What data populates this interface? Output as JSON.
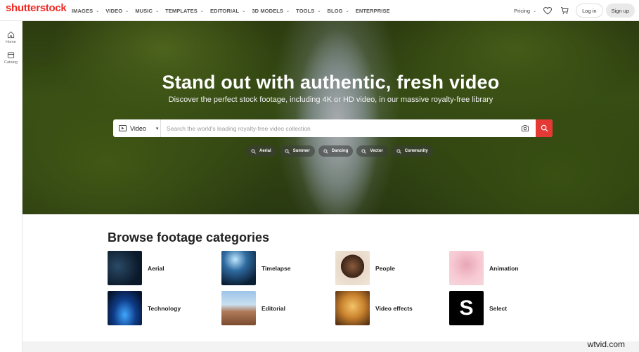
{
  "brand": {
    "logo": "shutterstock",
    "accent": "#ee2b24",
    "search_button_color": "#e53935"
  },
  "nav": {
    "items": [
      {
        "label": "IMAGES",
        "dropdown": true
      },
      {
        "label": "VIDEO",
        "dropdown": true
      },
      {
        "label": "MUSIC",
        "dropdown": true
      },
      {
        "label": "TEMPLATES",
        "dropdown": true
      },
      {
        "label": "EDITORIAL",
        "dropdown": true
      },
      {
        "label": "3D MODELS",
        "dropdown": true
      },
      {
        "label": "TOOLS",
        "dropdown": true
      },
      {
        "label": "BLOG",
        "dropdown": true
      },
      {
        "label": "ENTERPRISE",
        "dropdown": false
      }
    ],
    "pricing": "Pricing",
    "login": "Log in",
    "signup": "Sign up",
    "icons": [
      "heart-icon",
      "cart-icon"
    ]
  },
  "sidebar": {
    "items": [
      {
        "label": "Home",
        "icon": "home-icon"
      },
      {
        "label": "Catalog",
        "icon": "catalog-icon"
      }
    ]
  },
  "hero": {
    "title": "Stand out with authentic, fresh video",
    "subtitle": "Discover the perfect stock footage, including 4K or HD video, in our massive royalty-free library"
  },
  "search": {
    "type_label": "Video",
    "placeholder": "Search the world's leading royalty-free video collection"
  },
  "chips": [
    "Aerial",
    "Summer",
    "Dancing",
    "Vector",
    "Community"
  ],
  "browse": {
    "title": "Browse footage categories",
    "categories": [
      {
        "label": "Aerial"
      },
      {
        "label": "Timelapse"
      },
      {
        "label": "People"
      },
      {
        "label": "Animation"
      },
      {
        "label": "Technology"
      },
      {
        "label": "Editorial"
      },
      {
        "label": "Video effects"
      },
      {
        "label": "Select"
      }
    ],
    "select_thumb_letter": "S"
  },
  "watermark": "wtvid.com"
}
